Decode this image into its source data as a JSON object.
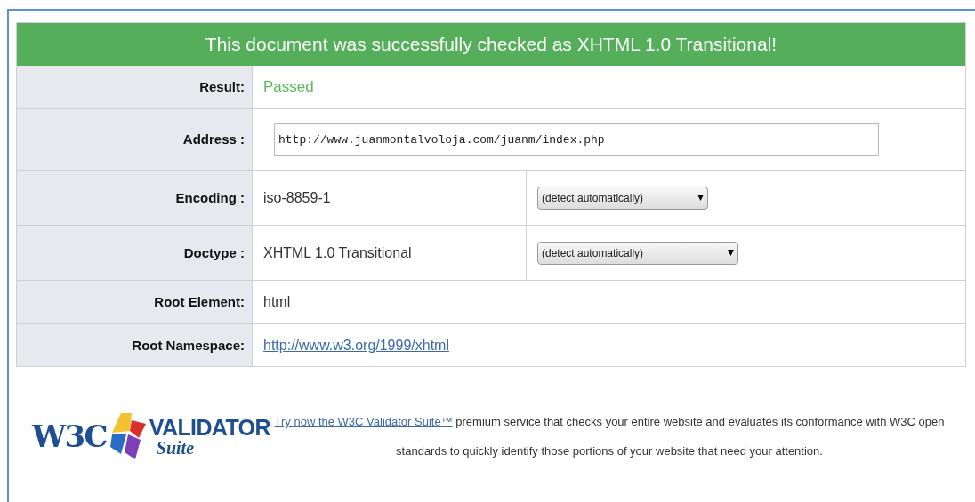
{
  "banner": "This document was successfully checked as XHTML 1.0 Transitional!",
  "rows": [
    {
      "kind": "result",
      "label": "Result:",
      "value": "Passed"
    },
    {
      "kind": "input",
      "label": "Address :",
      "value": "http://www.juanmontalvoloja.com/juanm/index.php"
    },
    {
      "kind": "select",
      "label": "Encoding :",
      "value": "iso-8859-1",
      "option": "(detect automatically)"
    },
    {
      "kind": "select",
      "label": "Doctype :",
      "value": "XHTML 1.0 Transitional",
      "option": "(detect automatically)"
    },
    {
      "kind": "text",
      "label": "Root Element:",
      "value": "html"
    },
    {
      "kind": "link",
      "label": "Root Namespace:",
      "value": "http://www.w3.org/1999/xhtml"
    }
  ],
  "promo": {
    "logo": {
      "w3c": "W3C",
      "name": "VALIDATOR",
      "sub": "Suite"
    },
    "link": "Try now the W3C Validator Suite™",
    "text": " premium service that checks your entire website and evaluates its conformance with W3C open standards to quickly identify those portions of your website that need your attention."
  }
}
